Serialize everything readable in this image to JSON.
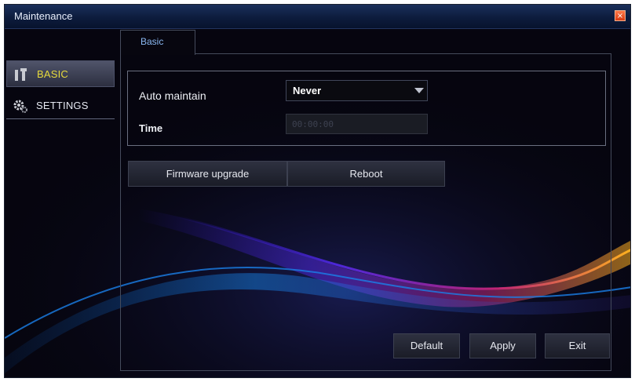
{
  "window": {
    "title": "Maintenance",
    "close_glyph": "×"
  },
  "sidebar": {
    "items": [
      {
        "label": "BASIC",
        "icon": "wrench-icon",
        "active": true
      },
      {
        "label": "SETTINGS",
        "icon": "gears-icon",
        "active": false
      }
    ]
  },
  "tabs": [
    {
      "label": "Basic",
      "active": true
    }
  ],
  "form": {
    "auto_maintain_label": "Auto maintain",
    "auto_maintain_value": "Never",
    "time_label": "Time",
    "time_value": "00:00:00"
  },
  "actions": {
    "firmware_upgrade": "Firmware upgrade",
    "reboot": "Reboot"
  },
  "footer": {
    "default": "Default",
    "apply": "Apply",
    "exit": "Exit"
  },
  "colors": {
    "active_sidebar_text": "#e6da3c",
    "tab_text": "#8ab8f2",
    "close_button": "#e8461c"
  }
}
